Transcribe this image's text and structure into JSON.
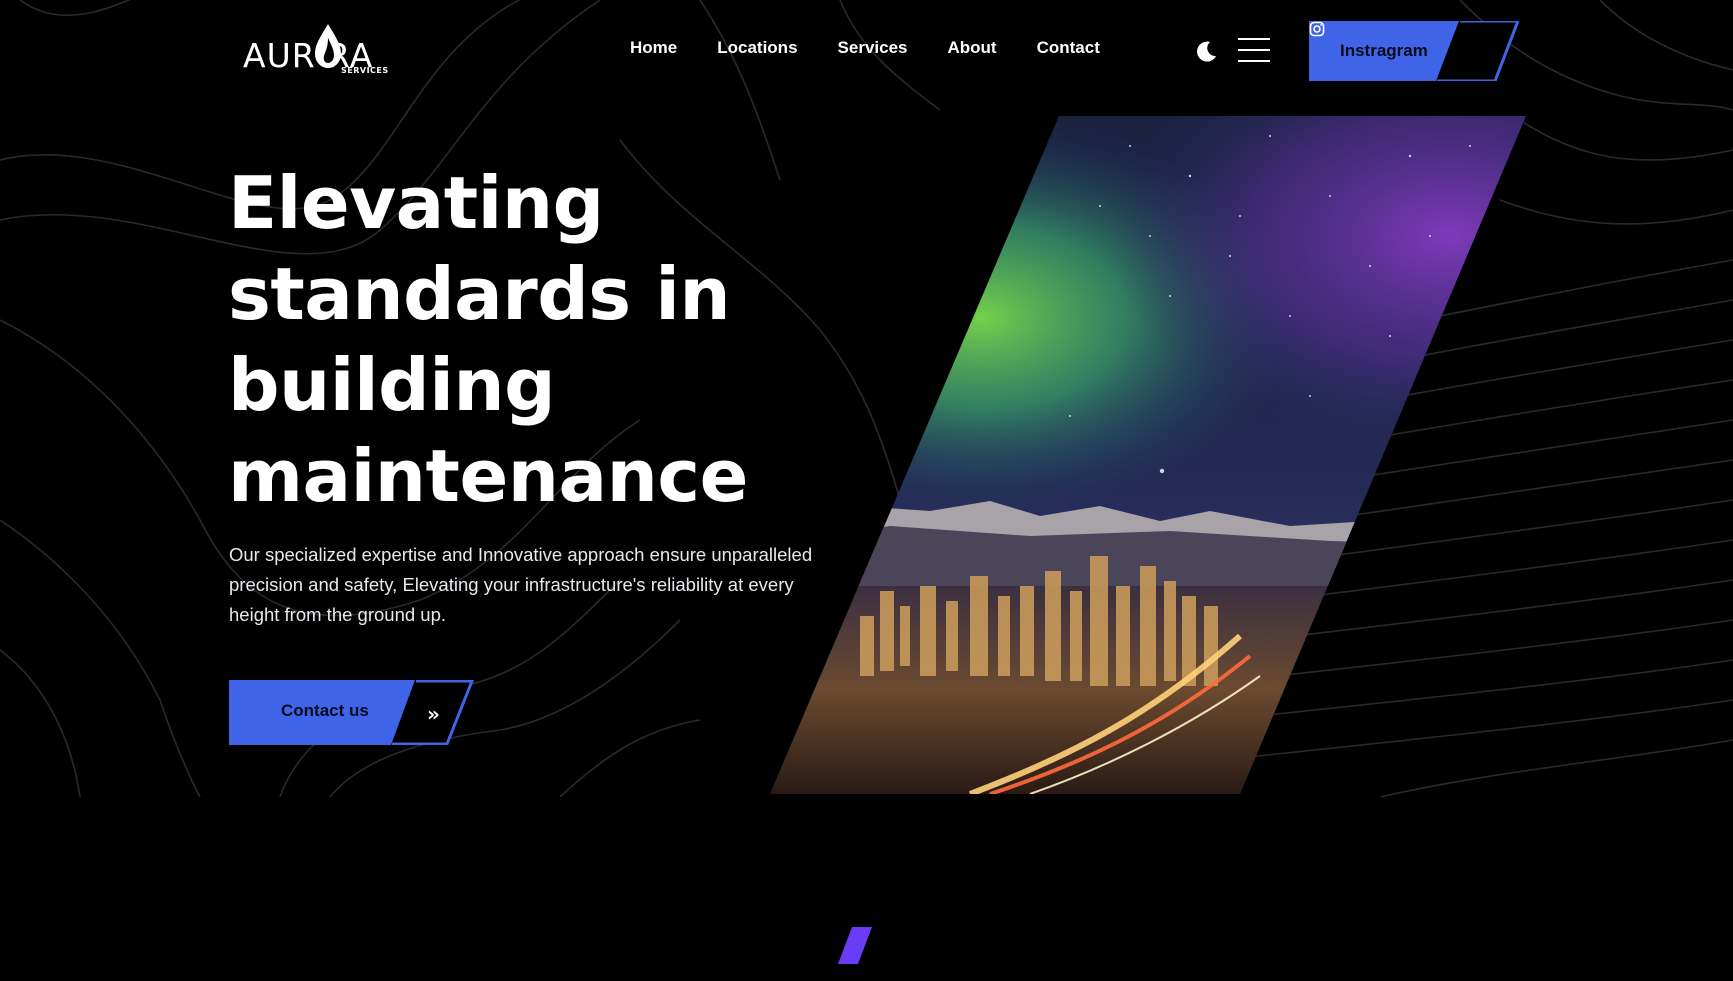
{
  "brand": {
    "name": "AURORA",
    "tagline": "SERVICES",
    "accent_color": "#4064e8",
    "violet_color": "#6a3cf5"
  },
  "nav": {
    "items": [
      "Home",
      "Locations",
      "Services",
      "About",
      "Contact"
    ]
  },
  "header": {
    "theme_toggle_icon": "moon-icon",
    "menu_icon": "hamburger-menu-icon",
    "social_button": {
      "label": "Instragram",
      "icon": "instagram-icon"
    }
  },
  "hero": {
    "title_lines": [
      "Elevating",
      "standards in",
      "building",
      "maintenance"
    ],
    "description": "Our specialized expertise and Innovative approach ensure unparalleled precision and safety, Elevating your infrastructure's reliability at every height from the ground up.",
    "cta": {
      "label": "Contact us",
      "icon": "double-chevron-right-icon"
    },
    "image": {
      "subject": "aurora-over-city-skyline"
    }
  }
}
